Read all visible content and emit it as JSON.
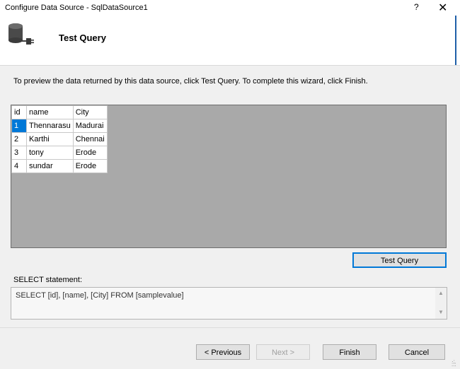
{
  "window": {
    "title": "Configure Data Source - SqlDataSource1",
    "help_glyph": "?",
    "close_glyph": "✕"
  },
  "header": {
    "icon": "database-connect-icon",
    "title": "Test Query"
  },
  "instructions": "To preview the data returned by this data source, click Test Query. To complete this wizard, click Finish.",
  "results": {
    "columns": [
      "id",
      "name",
      "City"
    ],
    "rows": [
      [
        "1",
        "Thennarasu",
        "Madurai"
      ],
      [
        "2",
        "Karthi",
        "Chennai"
      ],
      [
        "3",
        "tony",
        "Erode"
      ],
      [
        "4",
        "sundar",
        "Erode"
      ]
    ]
  },
  "test_query_button": "Test Query",
  "select_statement": {
    "label": "SELECT statement:",
    "value": "SELECT [id], [name], [City] FROM [samplevalue]"
  },
  "footer": {
    "previous": "< Previous",
    "next": "Next >",
    "finish": "Finish",
    "cancel": "Cancel"
  },
  "colors": {
    "selection": "#0078d7",
    "grid_background": "#a9a9a9",
    "accent_edge": "#1f5fa8"
  }
}
